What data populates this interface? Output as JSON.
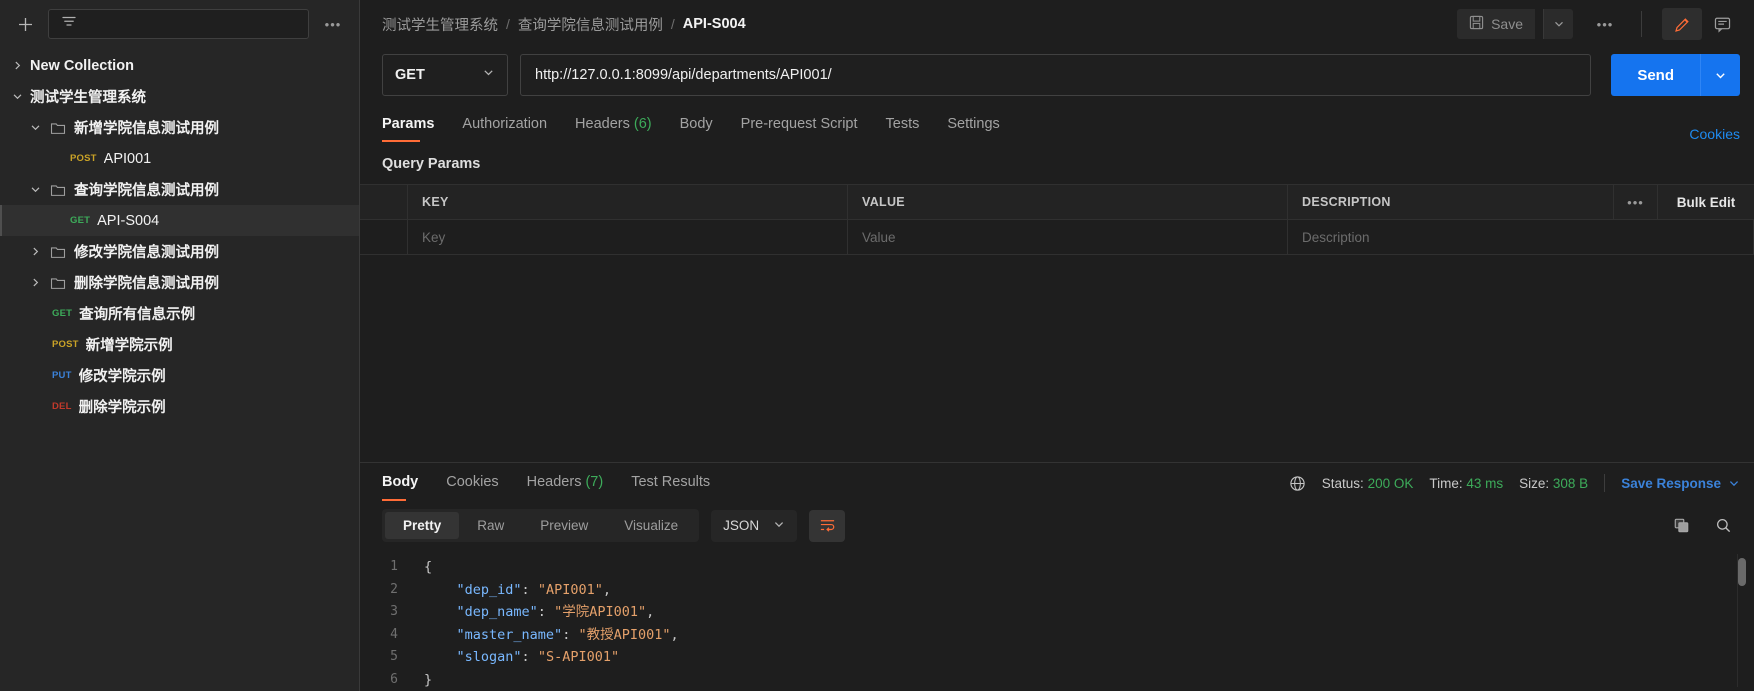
{
  "colors": {
    "accent": "#ff6c37",
    "send_blue": "#1574ef",
    "link_blue": "#1f8bf0",
    "status_green": "#3dab5a",
    "bg": "#1e1e1e",
    "sidebar_bg": "#262626"
  },
  "sidebar": {
    "new_label": "+",
    "filter_placeholder": "",
    "more_label": "•••",
    "items": [
      {
        "label": "New Collection",
        "type": "collection",
        "indent": 0,
        "chevron": "right",
        "selected": false,
        "bold": true
      },
      {
        "label": "测试学生管理系统",
        "type": "collection",
        "indent": 0,
        "chevron": "down",
        "selected": false,
        "bold": true
      },
      {
        "label": "新增学院信息测试用例",
        "type": "folder",
        "indent": 1,
        "chevron": "down",
        "selected": false,
        "bold": true
      },
      {
        "label": "API001",
        "type": "request",
        "method": "POST",
        "indent": 2,
        "selected": false,
        "bold": false
      },
      {
        "label": "查询学院信息测试用例",
        "type": "folder",
        "indent": 1,
        "chevron": "down",
        "selected": false,
        "bold": true
      },
      {
        "label": "API-S004",
        "type": "request",
        "method": "GET",
        "indent": 2,
        "selected": true,
        "bold": false
      },
      {
        "label": "修改学院信息测试用例",
        "type": "folder",
        "indent": 1,
        "chevron": "right",
        "selected": false,
        "bold": true
      },
      {
        "label": "删除学院信息测试用例",
        "type": "folder",
        "indent": 1,
        "chevron": "right",
        "selected": false,
        "bold": true
      },
      {
        "label": "查询所有信息示例",
        "type": "request",
        "method": "GET",
        "indent": 1,
        "selected": false,
        "bold": true
      },
      {
        "label": "新增学院示例",
        "type": "request",
        "method": "POST",
        "indent": 1,
        "selected": false,
        "bold": true
      },
      {
        "label": "修改学院示例",
        "type": "request",
        "method": "PUT",
        "indent": 1,
        "selected": false,
        "bold": true
      },
      {
        "label": "删除学院示例",
        "type": "request",
        "method": "DEL",
        "indent": 1,
        "selected": false,
        "bold": true
      }
    ]
  },
  "header": {
    "breadcrumb": [
      "测试学生管理系统",
      "查询学院信息测试用例",
      "API-S004"
    ],
    "separator": "/",
    "save_label": "Save",
    "more_label": "•••"
  },
  "request": {
    "method": "GET",
    "url": "http://127.0.0.1:8099/api/departments/API001/",
    "send_label": "Send",
    "tabs": [
      {
        "label": "Params",
        "active": true,
        "count": ""
      },
      {
        "label": "Authorization",
        "active": false,
        "count": ""
      },
      {
        "label": "Headers",
        "active": false,
        "count": "(6)"
      },
      {
        "label": "Body",
        "active": false,
        "count": ""
      },
      {
        "label": "Pre-request Script",
        "active": false,
        "count": ""
      },
      {
        "label": "Tests",
        "active": false,
        "count": ""
      },
      {
        "label": "Settings",
        "active": false,
        "count": ""
      }
    ],
    "cookies_link": "Cookies"
  },
  "query_params": {
    "title": "Query Params",
    "columns": [
      "KEY",
      "VALUE",
      "DESCRIPTION"
    ],
    "row_dots": "•••",
    "bulk_edit": "Bulk Edit",
    "rows": [
      {
        "key_placeholder": "Key",
        "value_placeholder": "Value",
        "description_placeholder": "Description"
      }
    ]
  },
  "response": {
    "tabs": [
      {
        "label": "Body",
        "active": true,
        "count": ""
      },
      {
        "label": "Cookies",
        "active": false,
        "count": ""
      },
      {
        "label": "Headers",
        "active": false,
        "count": "(7)"
      },
      {
        "label": "Test Results",
        "active": false,
        "count": ""
      }
    ],
    "status_label": "Status:",
    "status_value": "200 OK",
    "time_label": "Time:",
    "time_value": "43 ms",
    "size_label": "Size:",
    "size_value": "308 B",
    "save_response": "Save Response",
    "view_modes": [
      {
        "label": "Pretty",
        "active": true
      },
      {
        "label": "Raw",
        "active": false
      },
      {
        "label": "Preview",
        "active": false
      },
      {
        "label": "Visualize",
        "active": false
      }
    ],
    "format": "JSON",
    "body_lines": [
      {
        "n": "1",
        "tokens": [
          {
            "t": "{",
            "c": "c-brace"
          }
        ]
      },
      {
        "n": "2",
        "tokens": [
          {
            "t": "    ",
            "c": "c-punc"
          },
          {
            "t": "\"dep_id\"",
            "c": "c-key"
          },
          {
            "t": ": ",
            "c": "c-punc"
          },
          {
            "t": "\"API001\"",
            "c": "c-str"
          },
          {
            "t": ",",
            "c": "c-punc"
          }
        ]
      },
      {
        "n": "3",
        "tokens": [
          {
            "t": "    ",
            "c": "c-punc"
          },
          {
            "t": "\"dep_name\"",
            "c": "c-key"
          },
          {
            "t": ": ",
            "c": "c-punc"
          },
          {
            "t": "\"学院API001\"",
            "c": "c-str"
          },
          {
            "t": ",",
            "c": "c-punc"
          }
        ]
      },
      {
        "n": "4",
        "tokens": [
          {
            "t": "    ",
            "c": "c-punc"
          },
          {
            "t": "\"master_name\"",
            "c": "c-key"
          },
          {
            "t": ": ",
            "c": "c-punc"
          },
          {
            "t": "\"教授API001\"",
            "c": "c-str"
          },
          {
            "t": ",",
            "c": "c-punc"
          }
        ]
      },
      {
        "n": "5",
        "tokens": [
          {
            "t": "    ",
            "c": "c-punc"
          },
          {
            "t": "\"slogan\"",
            "c": "c-key"
          },
          {
            "t": ": ",
            "c": "c-punc"
          },
          {
            "t": "\"S-API001\"",
            "c": "c-str"
          }
        ]
      },
      {
        "n": "6",
        "tokens": [
          {
            "t": "}",
            "c": "c-brace"
          }
        ]
      }
    ]
  }
}
